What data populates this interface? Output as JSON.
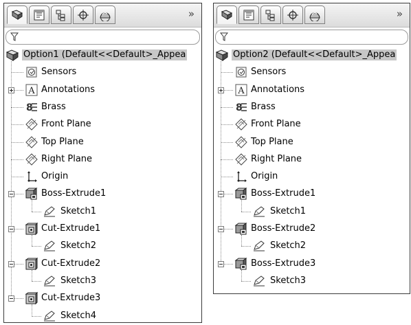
{
  "panels": [
    {
      "root_label": "Option1  (Default<<Default>_Appea",
      "features": [
        {
          "label": "Sensors",
          "icon": "sensors-icon"
        },
        {
          "label": "Annotations",
          "icon": "annotations-icon",
          "expander": "plus"
        },
        {
          "label": "Brass",
          "icon": "material-icon"
        },
        {
          "label": "Front Plane",
          "icon": "plane-icon"
        },
        {
          "label": "Top Plane",
          "icon": "plane-icon"
        },
        {
          "label": "Right Plane",
          "icon": "plane-icon"
        },
        {
          "label": "Origin",
          "icon": "origin-icon"
        },
        {
          "label": "Boss-Extrude1",
          "icon": "boss-extrude-icon",
          "expander": "minus",
          "child": "Sketch1"
        },
        {
          "label": "Cut-Extrude1",
          "icon": "cut-extrude-icon",
          "expander": "minus",
          "child": "Sketch2"
        },
        {
          "label": "Cut-Extrude2",
          "icon": "cut-extrude-icon",
          "expander": "minus",
          "child": "Sketch3"
        },
        {
          "label": "Cut-Extrude3",
          "icon": "cut-extrude-icon",
          "expander": "minus",
          "child": "Sketch4"
        }
      ]
    },
    {
      "root_label": "Option2  (Default<<Default>_Appea",
      "features": [
        {
          "label": "Sensors",
          "icon": "sensors-icon"
        },
        {
          "label": "Annotations",
          "icon": "annotations-icon",
          "expander": "plus"
        },
        {
          "label": "Brass",
          "icon": "material-icon"
        },
        {
          "label": "Front Plane",
          "icon": "plane-icon"
        },
        {
          "label": "Top Plane",
          "icon": "plane-icon"
        },
        {
          "label": "Right Plane",
          "icon": "plane-icon"
        },
        {
          "label": "Origin",
          "icon": "origin-icon"
        },
        {
          "label": "Boss-Extrude1",
          "icon": "boss-extrude-icon",
          "expander": "minus",
          "child": "Sketch1"
        },
        {
          "label": "Boss-Extrude2",
          "icon": "boss-extrude-icon",
          "expander": "minus",
          "child": "Sketch2"
        },
        {
          "label": "Boss-Extrude3",
          "icon": "boss-extrude-icon",
          "expander": "minus",
          "child": "Sketch3"
        }
      ]
    }
  ],
  "toolbar_tabs": [
    "featuremanager-icon",
    "propertymanager-icon",
    "configurationmanager-icon",
    "dimxpert-icon",
    "display-manager-icon"
  ],
  "toolbar_more": "»",
  "filter_icon": "filter-icon",
  "colors": {
    "selected_row": "#c7c7c7",
    "panel_border": "#3a3a3a"
  }
}
